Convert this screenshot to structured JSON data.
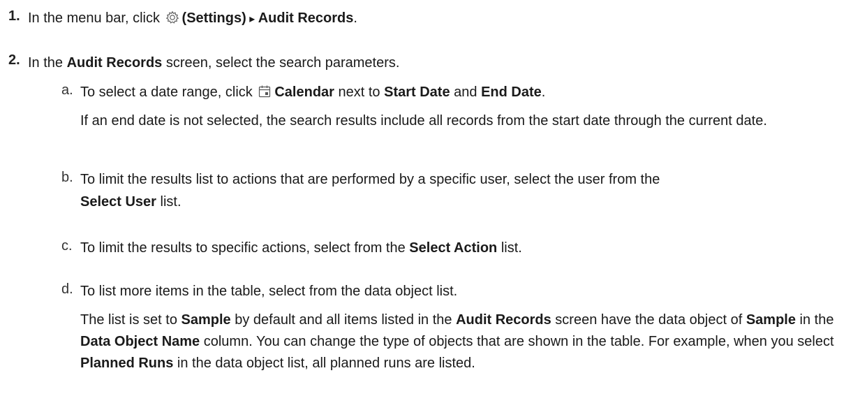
{
  "steps": [
    {
      "number": "1.",
      "parts": [
        "In the menu bar, click ",
        "(Settings)",
        " ▸ ",
        "Audit Records",
        "."
      ],
      "icon": "gear-icon"
    },
    {
      "number": "2.",
      "parts": [
        "In the ",
        "Audit Records",
        " screen, select the search parameters."
      ],
      "substeps": [
        {
          "letter": "a.",
          "parts": [
            "To select a date range, click ",
            "Calendar",
            " next to ",
            "Start Date",
            " and ",
            "End Date",
            "."
          ],
          "icon": "calendar-icon",
          "note": "If an end date is not selected, the search results include all records from the start date through the current date."
        },
        {
          "letter": "b.",
          "parts": [
            "To limit the results list to actions that are performed by a specific user, select the user from the",
            "Select User",
            " list."
          ]
        },
        {
          "letter": "c.",
          "parts": [
            "To limit the results to specific actions, select from the ",
            "Select Action",
            " list."
          ]
        },
        {
          "letter": "d.",
          "parts": [
            "To list more items in the table, select from the data object list."
          ],
          "note_parts": [
            "The list is set to ",
            "Sample",
            " by default and all items listed in the ",
            "Audit Records",
            " screen have the data object of ",
            "Sample",
            " in the ",
            "Data Object Name",
            " column. You can change the type of objects that are shown in the table. For example, when you select ",
            "Planned Runs",
            " in the data object list, all planned runs are listed."
          ]
        }
      ]
    }
  ]
}
